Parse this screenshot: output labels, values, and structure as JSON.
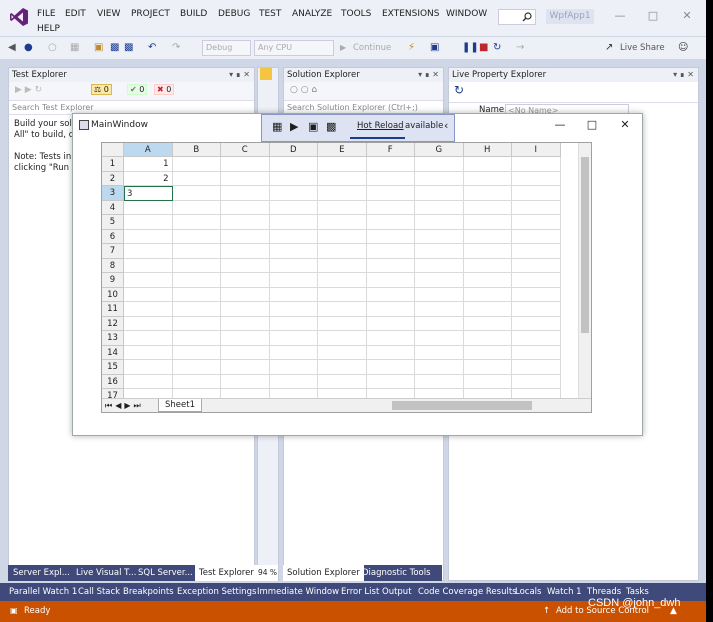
{
  "menu": {
    "items": [
      "FILE",
      "EDIT",
      "VIEW",
      "PROJECT",
      "BUILD",
      "DEBUG",
      "TEST",
      "ANALYZE",
      "TOOLS",
      "EXTENSIONS",
      "WINDOW"
    ],
    "help": "HELP",
    "search_icon": "search-icon",
    "app_title": "WpfApp1"
  },
  "toolbar": {
    "config": "Debug",
    "platform": "Any CPU",
    "continue": "Continue",
    "live_share": "Live Share"
  },
  "test_explorer": {
    "title": "Test Explorer",
    "counts": [
      "0",
      "0",
      "0"
    ],
    "search_placeholder": "Search Test Explorer",
    "body_line1": "Build your solu",
    "body_line2": "All\" to build, di",
    "body_line3": "Note: Tests in U",
    "body_line4": "clicking \"Run A"
  },
  "solution_explorer": {
    "title": "Solution Explorer",
    "search_placeholder": "Search Solution Explorer (Ctrl+;)"
  },
  "live_property": {
    "title": "Live Property Explorer",
    "name_label": "Name",
    "name_value": "<No Name>"
  },
  "main_window": {
    "title": "MainWindow",
    "hot_reload": "Hot Reload",
    "available": "available"
  },
  "grid": {
    "columns": [
      "A",
      "B",
      "C",
      "D",
      "E",
      "F",
      "G",
      "H",
      "I"
    ],
    "rows": [
      "1",
      "2",
      "3",
      "4",
      "5",
      "6",
      "7",
      "8",
      "9",
      "10",
      "11",
      "12",
      "13",
      "14",
      "15",
      "16",
      "17"
    ],
    "cells": {
      "A1": "1",
      "A2": "2",
      "A3": "3"
    },
    "sheet": "Sheet1"
  },
  "left_bottom_tabs": [
    "Server Expl...",
    "Live Visual T...",
    "SQL Server...",
    "Test Explorer"
  ],
  "zoom": "94 %",
  "mid_bottom_tabs": [
    "Solution Explorer",
    "Diagnostic Tools"
  ],
  "tool_windows": [
    "Parallel Watch 1",
    "Call Stack",
    "Breakpoints",
    "Exception Settings",
    "Immediate Window",
    "Error List",
    "Output",
    "Code Coverage Results",
    "Locals",
    "Watch 1",
    "Threads",
    "Tasks"
  ],
  "status": {
    "ready": "Ready",
    "source_control": "Add to Source Control",
    "watermark": "CSDN @john_dwh"
  },
  "colors": {
    "accent": "#ca5100",
    "toolwin_bar": "#3f4a7a",
    "selected_header": "#bcd9ef"
  }
}
